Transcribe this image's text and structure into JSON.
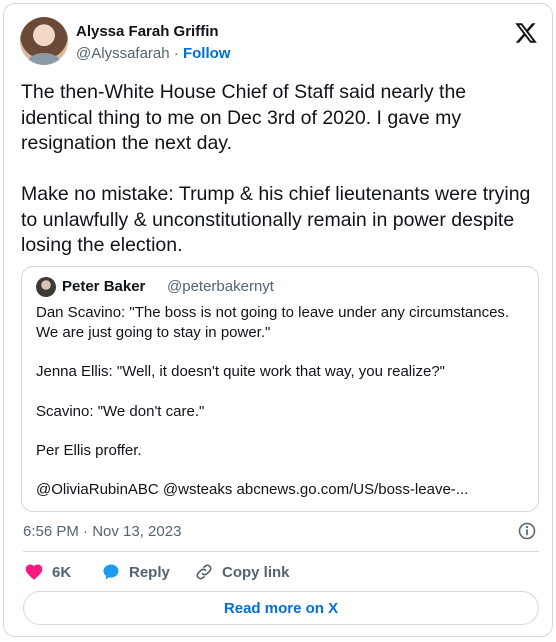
{
  "author": {
    "name": "Alyssa Farah Griffin",
    "handle": "@Alyssafarah",
    "separator": "·",
    "follow_label": "Follow"
  },
  "tweet": {
    "text": "The then-White House Chief of Staff said nearly the identical thing to me on Dec 3rd of 2020. I gave my resignation the next day.\n\nMake no mistake: Trump & his chief lieutenants were trying to unlawfully & unconstitutionally remain in power despite losing the election."
  },
  "quoted_tweet": {
    "name": "Peter Baker",
    "handle": "@peterbakernyt",
    "text": "Dan Scavino: \"The boss is not going to leave under any circumstances. We are just going to stay in power.\"\n\nJenna Ellis: \"Well, it doesn't quite work that way, you realize?\"\n\nScavino: \"We don't care.\"\n\nPer Ellis proffer.\n\n@OliviaRubinABC @wsteaks abcnews.go.com/US/boss-leave-..."
  },
  "timestamp": "6:56 PM · Nov 13, 2023",
  "actions": {
    "like_count": "6K",
    "reply_label": "Reply",
    "copy_link_label": "Copy link"
  },
  "read_more_label": "Read more on X",
  "icons": {
    "logo": "x-logo-icon",
    "info": "info-icon",
    "like": "heart-icon",
    "reply": "speech-bubble-icon",
    "copy_link": "link-icon"
  },
  "colors": {
    "text": "#0f1419",
    "secondary": "#536471",
    "link": "#006fd6",
    "like": "#f91880",
    "reply": "#1d9bf0",
    "border": "#cfd9de"
  }
}
